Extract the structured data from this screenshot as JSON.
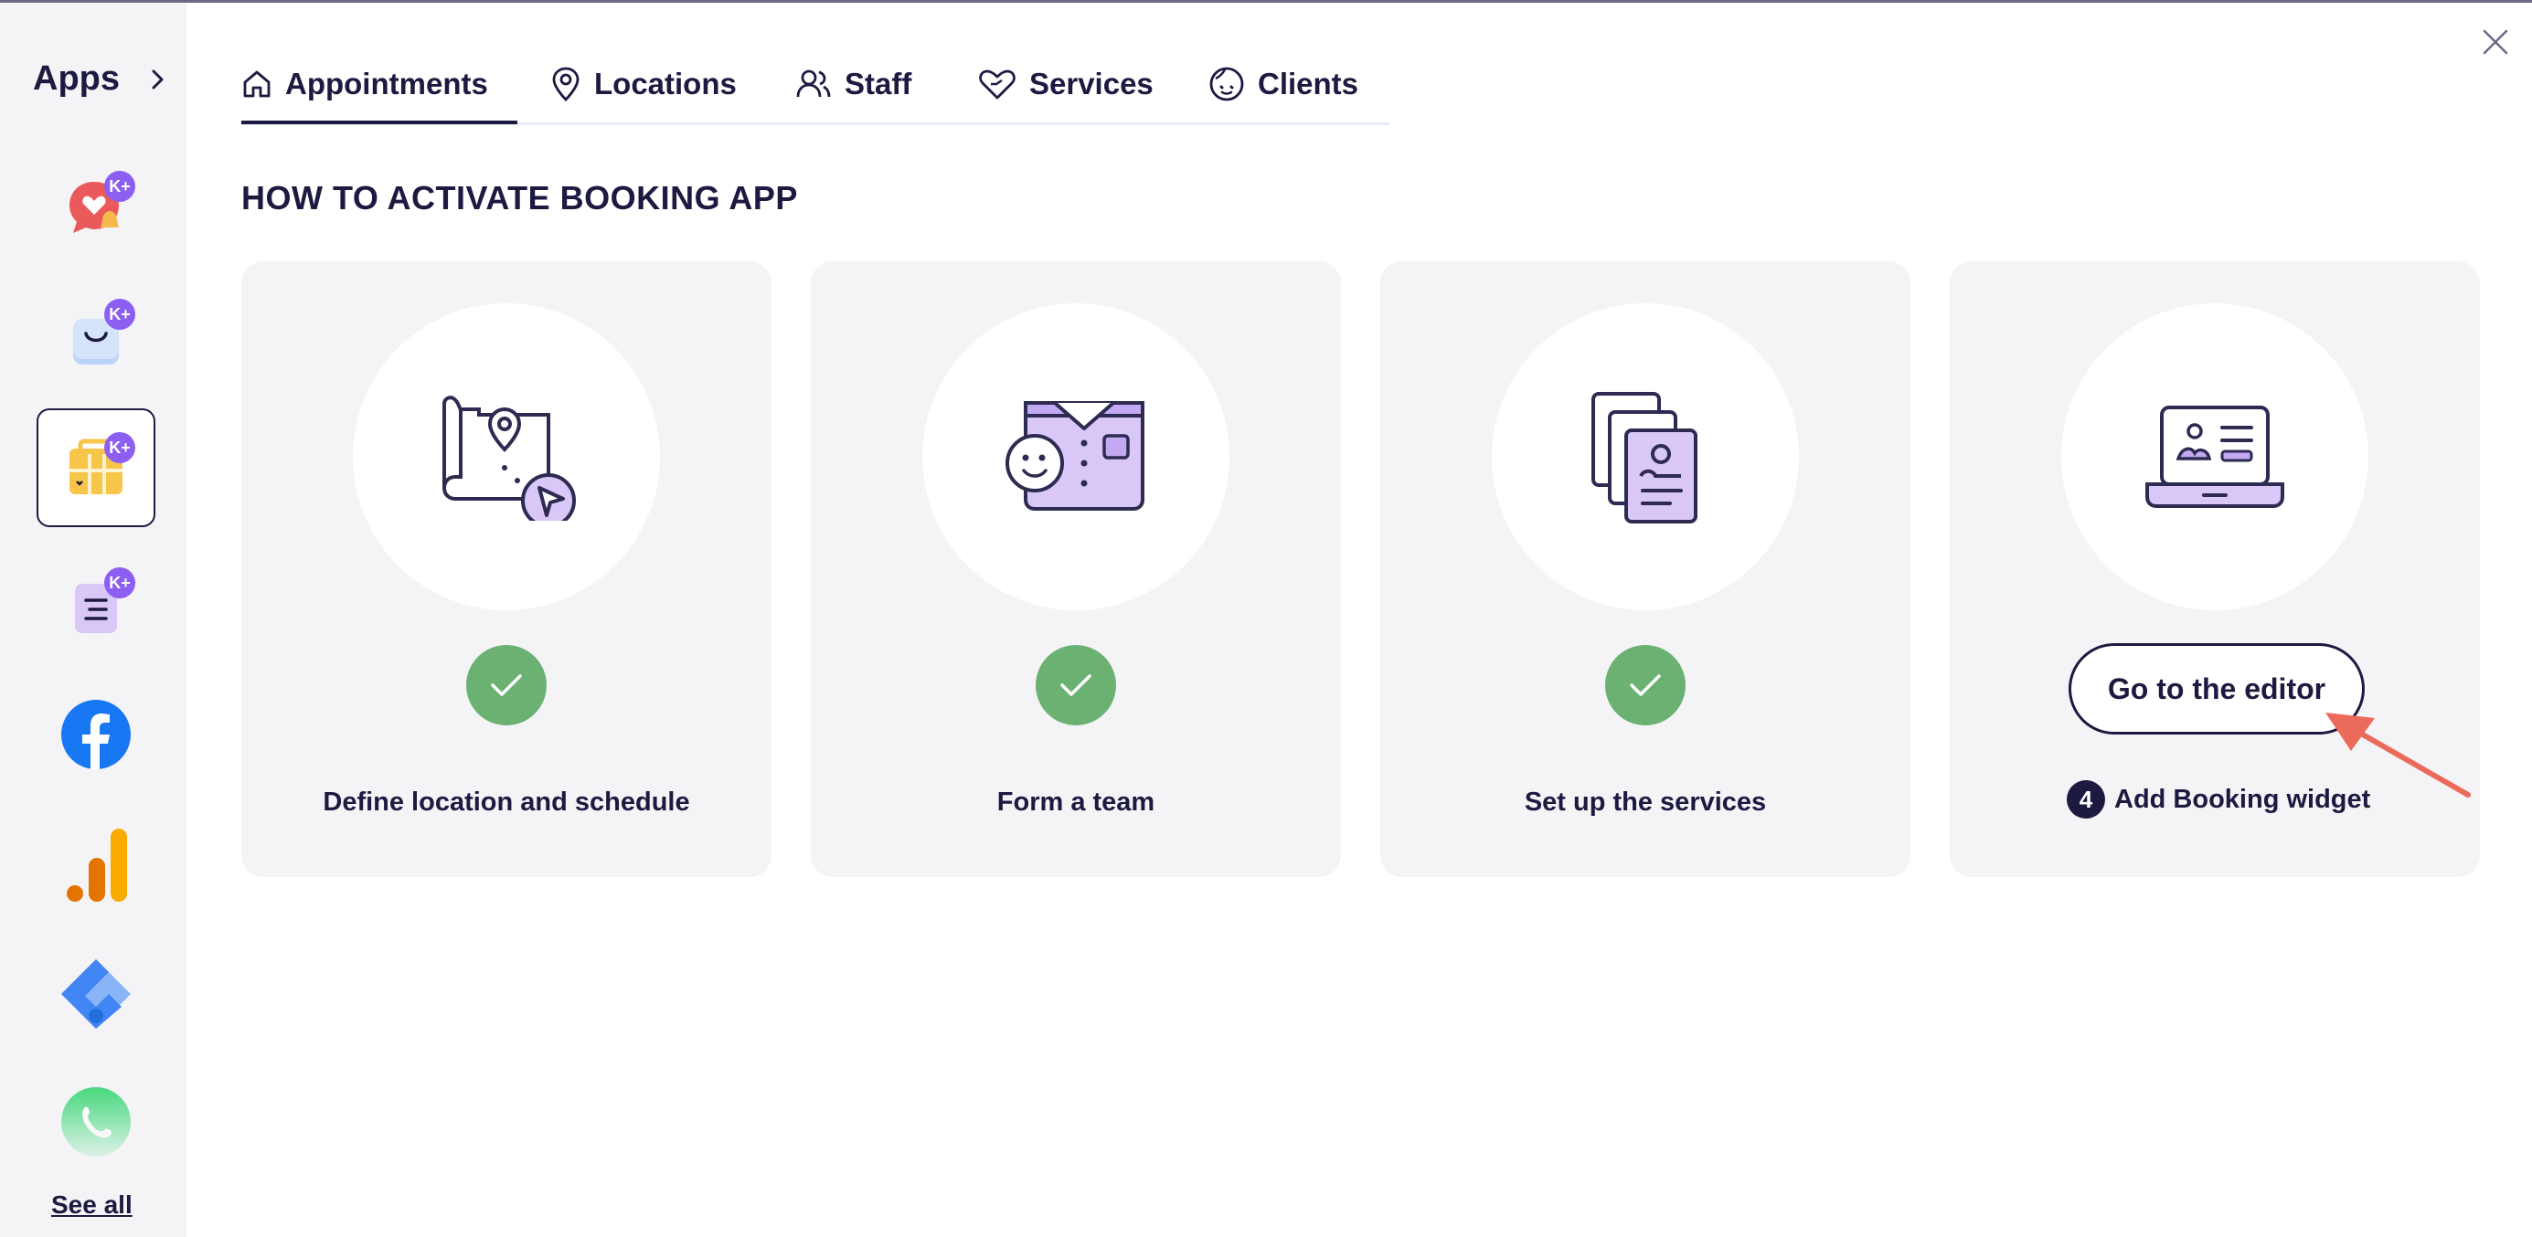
{
  "sidebar": {
    "title": "Apps",
    "see_all": "See all",
    "apps": [
      {
        "icon": "heart-chat-icon",
        "badge": "K+"
      },
      {
        "icon": "shopping-bag-icon",
        "badge": "K+"
      },
      {
        "icon": "calendar-booking-icon",
        "badge": "K+",
        "selected": true
      },
      {
        "icon": "document-form-icon",
        "badge": "K+"
      },
      {
        "icon": "facebook-icon"
      },
      {
        "icon": "analytics-bars-icon"
      },
      {
        "icon": "tag-manager-icon"
      },
      {
        "icon": "phone-icon"
      }
    ]
  },
  "tabs": [
    {
      "label": "Appointments",
      "icon": "home-icon",
      "active": true
    },
    {
      "label": "Locations",
      "icon": "map-pin-icon"
    },
    {
      "label": "Staff",
      "icon": "users-icon"
    },
    {
      "label": "Services",
      "icon": "heart-hand-icon"
    },
    {
      "label": "Clients",
      "icon": "face-icon"
    }
  ],
  "heading": "HOW TO ACTIVATE BOOKING APP",
  "steps": [
    {
      "label": "Define location and schedule",
      "status": "done",
      "icon": "map-location-icon"
    },
    {
      "label": "Form a team",
      "status": "done",
      "icon": "team-shirt-icon"
    },
    {
      "label": "Set up the services",
      "status": "done",
      "icon": "service-docs-icon"
    },
    {
      "label": "Add Booking widget",
      "status": "pending",
      "number": "4",
      "icon": "laptop-editor-icon",
      "button": "Go to the editor"
    }
  ],
  "colors": {
    "primary": "#1c1a40",
    "success": "#6bb272",
    "badge": "#8c5ff2",
    "annotation_arrow": "#ec6a5a",
    "card_bg": "#f4f4f7"
  }
}
